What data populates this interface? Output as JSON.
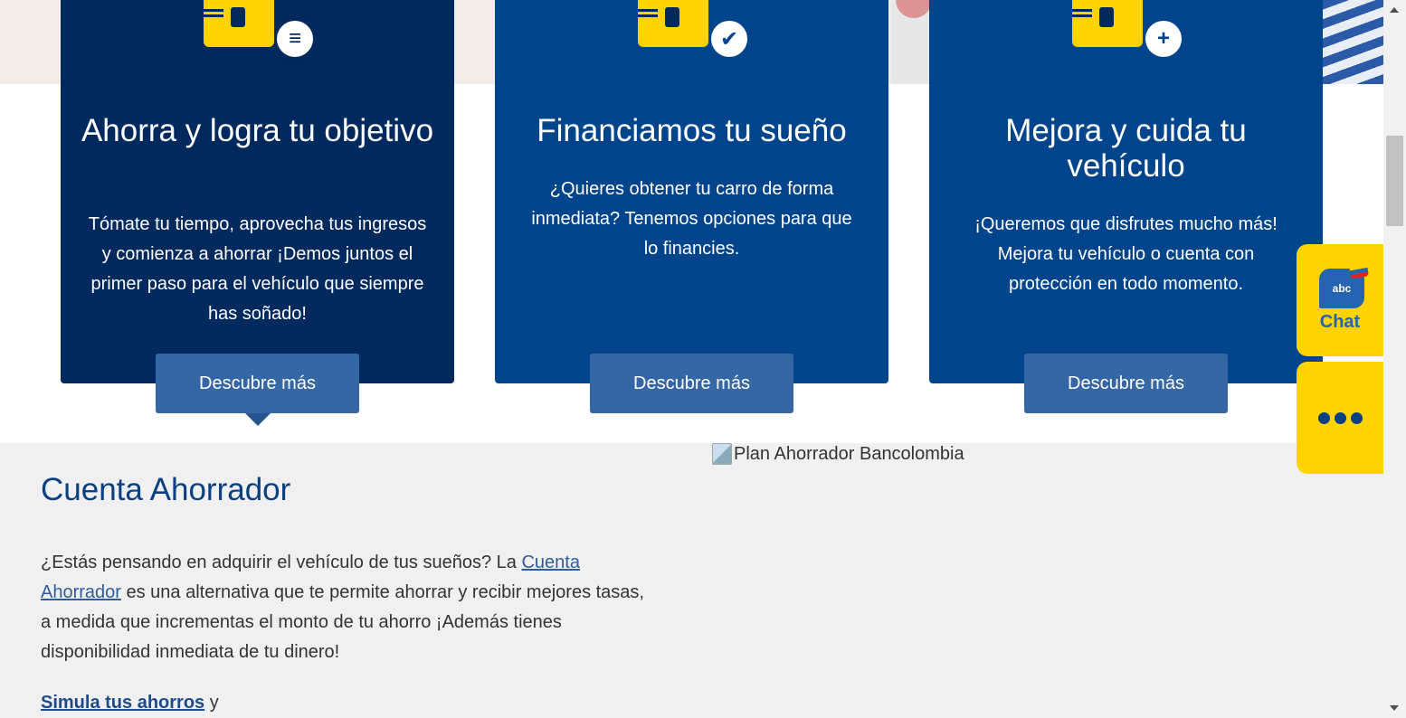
{
  "cards": [
    {
      "icon": "coins-icon",
      "badge_glyph": "≡",
      "title": "Ahorra y logra tu objetivo",
      "text": "Tómate tu tiempo, aprovecha tus ingresos y comienza a ahorrar ¡Demos juntos el primer paso para el vehículo que siempre has soñado!",
      "button": "Descubre más"
    },
    {
      "icon": "check-icon",
      "badge_glyph": "✔",
      "title": "Financiamos tu sueño",
      "text": "¿Quieres obtener tu carro de forma inmediata? Tenemos opciones para que lo financies.",
      "button": "Descubre más"
    },
    {
      "icon": "plus-icon",
      "badge_glyph": "+",
      "title": "Mejora y cuida tu vehículo",
      "text": "¡Queremos que disfrutes mucho más! Mejora tu vehículo o cuenta con protección en todo momento.",
      "button": "Descubre más"
    }
  ],
  "section": {
    "title": "Cuenta Ahorrador",
    "para_before": "¿Estás pensando en adquirir el vehículo de tus sueños?  La ",
    "link_text": "Cuenta Ahorrador",
    "para_after": " es una alternativa que te permite ahorrar y recibir mejores tasas, a medida que incrementas el monto de tu ahorro ¡Además tienes disponibilidad inmediata de tu dinero!",
    "simula_link": "Simula tus ahorros",
    "simula_after": " y",
    "image_alt": "Plan Ahorrador Bancolombia"
  },
  "chat": {
    "bubble_text": "abc",
    "label": "Chat"
  },
  "colors": {
    "card_dark": "#00295e",
    "card_blue": "#00448c",
    "button": "#3467a3",
    "accent_yellow": "#fdd300",
    "heading_blue": "#0a3f82"
  }
}
